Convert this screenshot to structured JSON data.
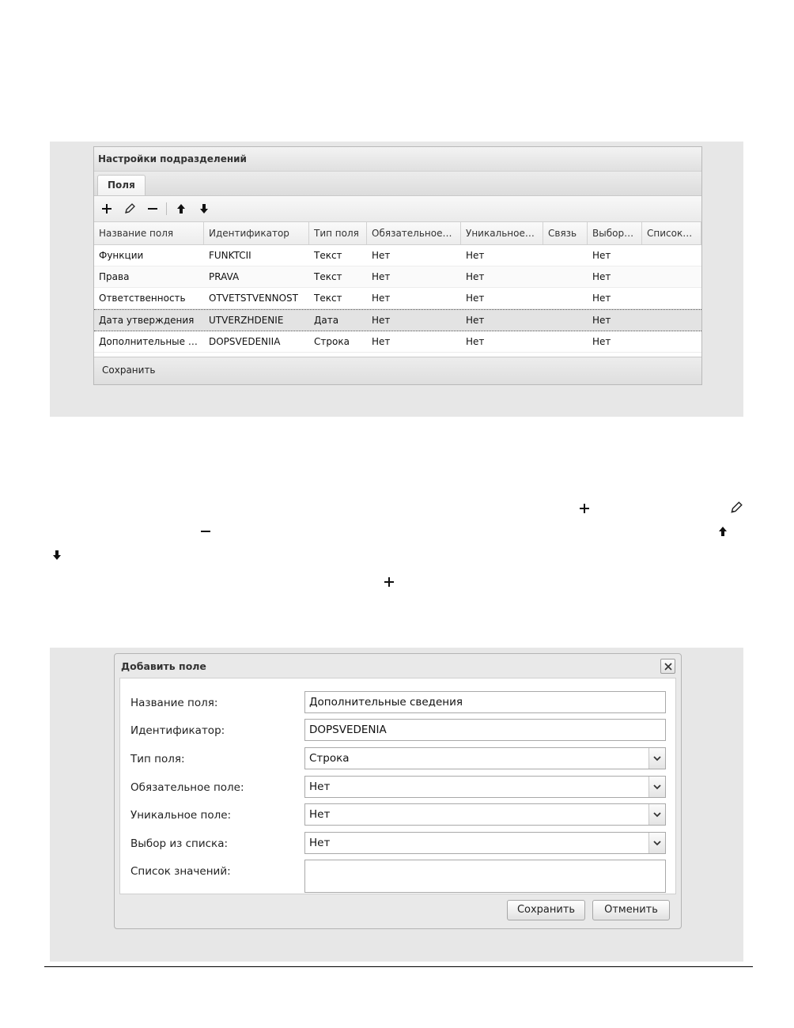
{
  "panel": {
    "title": "Настройки подразделений",
    "tab": "Поля",
    "columns": [
      "Название поля",
      "Идентификатор",
      "Тип поля",
      "Обязательное…",
      "Уникальное…",
      "Связь",
      "Выбор…",
      "Список…"
    ],
    "rows": [
      [
        "Функции",
        "FUNKTCII",
        "Текст",
        "Нет",
        "Нет",
        "",
        "Нет",
        ""
      ],
      [
        "Права",
        "PRAVA",
        "Текст",
        "Нет",
        "Нет",
        "",
        "Нет",
        ""
      ],
      [
        "Ответственность",
        "OTVETSTVENNOST",
        "Текст",
        "Нет",
        "Нет",
        "",
        "Нет",
        ""
      ],
      [
        "Дата утверждения",
        "UTVERZHDENIE",
        "Дата",
        "Нет",
        "Нет",
        "",
        "Нет",
        ""
      ],
      [
        "Дополнительные …",
        "DOPSVEDENIIA",
        "Строка",
        "Нет",
        "Нет",
        "",
        "Нет",
        ""
      ]
    ],
    "selected_row": 3,
    "save_label": "Сохранить"
  },
  "dialog": {
    "title": "Добавить поле",
    "fields": {
      "name": {
        "label": "Название поля:",
        "value": "Дополнительные сведения"
      },
      "id": {
        "label": "Идентификатор:",
        "value": "DOPSVEDENIA"
      },
      "type": {
        "label": "Тип поля:",
        "value": "Строка"
      },
      "required": {
        "label": "Обязательное поле:",
        "value": "Нет"
      },
      "unique": {
        "label": "Уникальное поле:",
        "value": "Нет"
      },
      "choice": {
        "label": "Выбор из списка:",
        "value": "Нет"
      },
      "values": {
        "label": "Список значений:",
        "value": ""
      }
    },
    "save_label": "Сохранить",
    "cancel_label": "Отменить"
  },
  "icons": {
    "add": "plus-icon",
    "edit": "pencil-icon",
    "remove": "minus-icon",
    "up": "arrow-up-icon",
    "down": "arrow-down-icon",
    "close": "close-icon",
    "dropdown": "chevron-down-icon"
  }
}
